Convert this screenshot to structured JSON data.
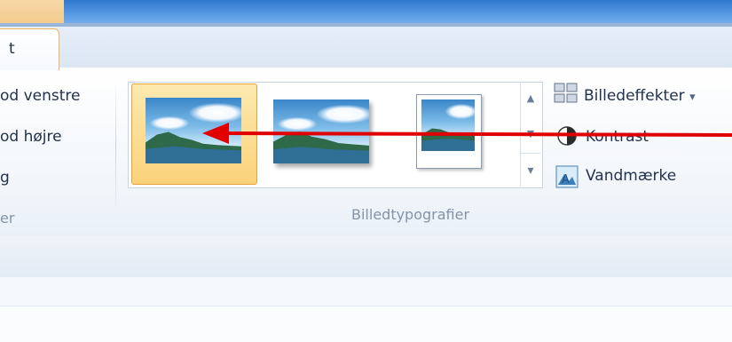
{
  "tabs": {
    "active_label": "t"
  },
  "left_group": {
    "items": [
      {
        "label": "od venstre"
      },
      {
        "label": "od højre"
      },
      {
        "label": "g"
      }
    ],
    "group_label": "er"
  },
  "gallery": {
    "group_label": "Billedtypografier",
    "styles": [
      {
        "name": "picture-style-plain",
        "selected": true
      },
      {
        "name": "picture-style-shadow",
        "selected": false
      },
      {
        "name": "picture-style-frame",
        "selected": false
      }
    ],
    "scroll_up": "▲",
    "scroll_down": "▼",
    "more": "▾"
  },
  "right_group": {
    "effects_label": "Billedeffekter",
    "effects_dropdown": "▾",
    "contrast_label": "Kontrast",
    "watermark_label": "Vandmærke"
  },
  "annotation": {
    "arrow_color": "#e00000"
  },
  "colors": {
    "accent": "#2f78cf",
    "selected": "#fbd27a"
  }
}
